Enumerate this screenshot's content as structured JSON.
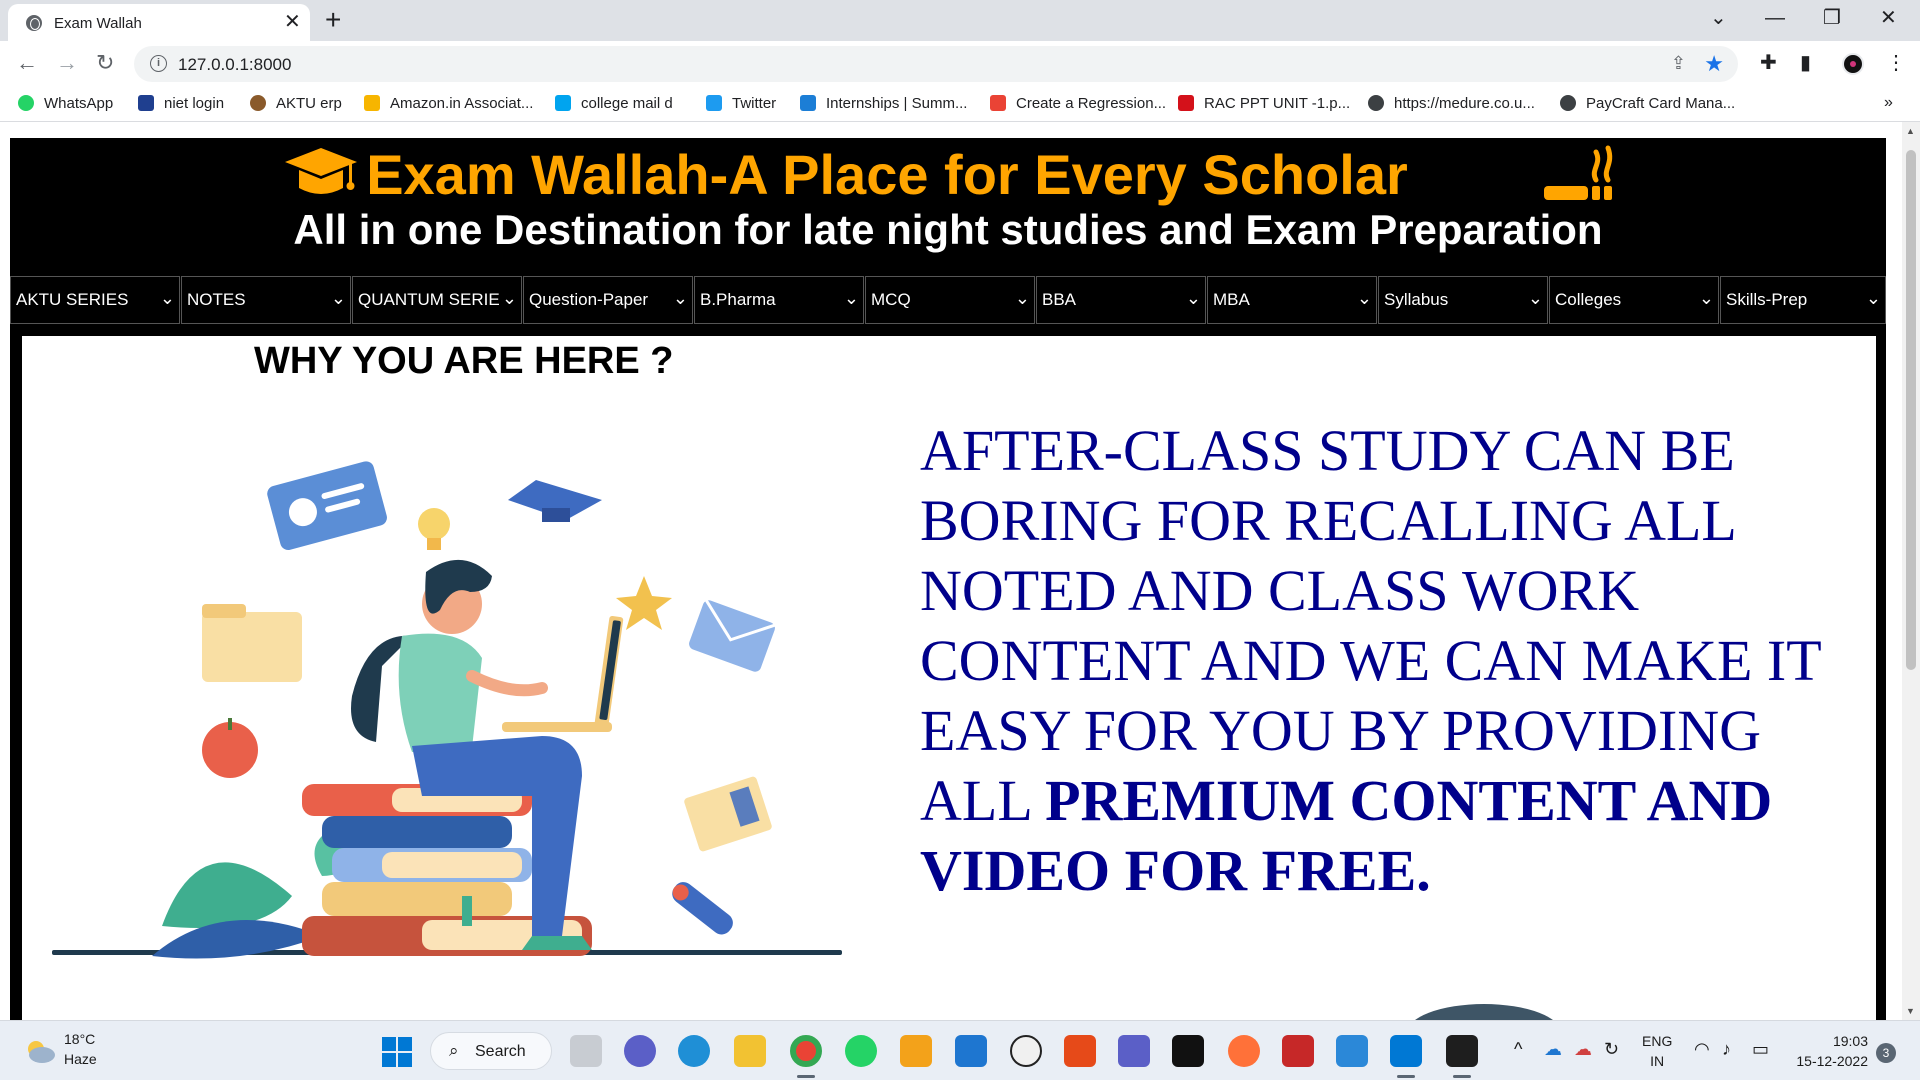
{
  "browser": {
    "tab_title": "Exam Wallah",
    "tab_close": "✕",
    "new_tab": "+",
    "url": "127.0.0.1:8000",
    "win_controls": {
      "dropdown": "⌄",
      "minimize": "—",
      "restore": "❐",
      "close": "✕"
    }
  },
  "bookmarks": [
    {
      "label": "WhatsApp",
      "color": "#25d366"
    },
    {
      "label": "niet login",
      "color": "#1f3f8f"
    },
    {
      "label": "AKTU erp",
      "color": "#8a5a2b"
    },
    {
      "label": "Amazon.in Associat...",
      "color": "#f7b500"
    },
    {
      "label": "college mail d",
      "color": "#00a4ef"
    },
    {
      "label": "Twitter",
      "color": "#1d9bf0"
    },
    {
      "label": "Internships | Summ...",
      "color": "#1c7ed6"
    },
    {
      "label": "Create a Regression...",
      "color": "#ea4335"
    },
    {
      "label": "RAC PPT UNIT -1.p...",
      "color": "#d4111a"
    },
    {
      "label": "https://medure.co.u...",
      "color": "#3c4043"
    },
    {
      "label": "PayCraft Card Mana...",
      "color": "#3c4043"
    }
  ],
  "bookmarks_more": "»",
  "site": {
    "title": "Exam Wallah-A Place for Every Scholar",
    "tagline": "All in one Destination for late night studies and Exam Preparation",
    "menu": [
      "AKTU SERIES",
      "NOTES",
      "QUANTUM SERIES",
      "Question-Paper",
      "B.Pharma",
      "MCQ",
      "BBA",
      "MBA",
      "Syllabus",
      "Colleges",
      "Skills-Prep"
    ],
    "menu_caret": "⌄",
    "heading": "WHY YOU ARE HERE ?",
    "pitch_plain": "AFTER-CLASS STUDY CAN BE BORING FOR RECALLING ALL NOTED AND CLASS WORK CONTENT AND WE CAN MAKE IT EASY FOR YOU BY PROVIDING ALL ",
    "pitch_bold": "PREMIUM CONTENT AND VIDEO FOR FREE."
  },
  "taskbar": {
    "weather_temp": "18°C",
    "weather_cond": "Haze",
    "search_label": "Search",
    "lang_top": "ENG",
    "lang_bottom": "IN",
    "time": "19:03",
    "date": "15-12-2022",
    "notifications": "3"
  },
  "colors": {
    "title_orange": "#ffa500",
    "pitch_blue": "#00008b",
    "header_bg": "#000000"
  }
}
